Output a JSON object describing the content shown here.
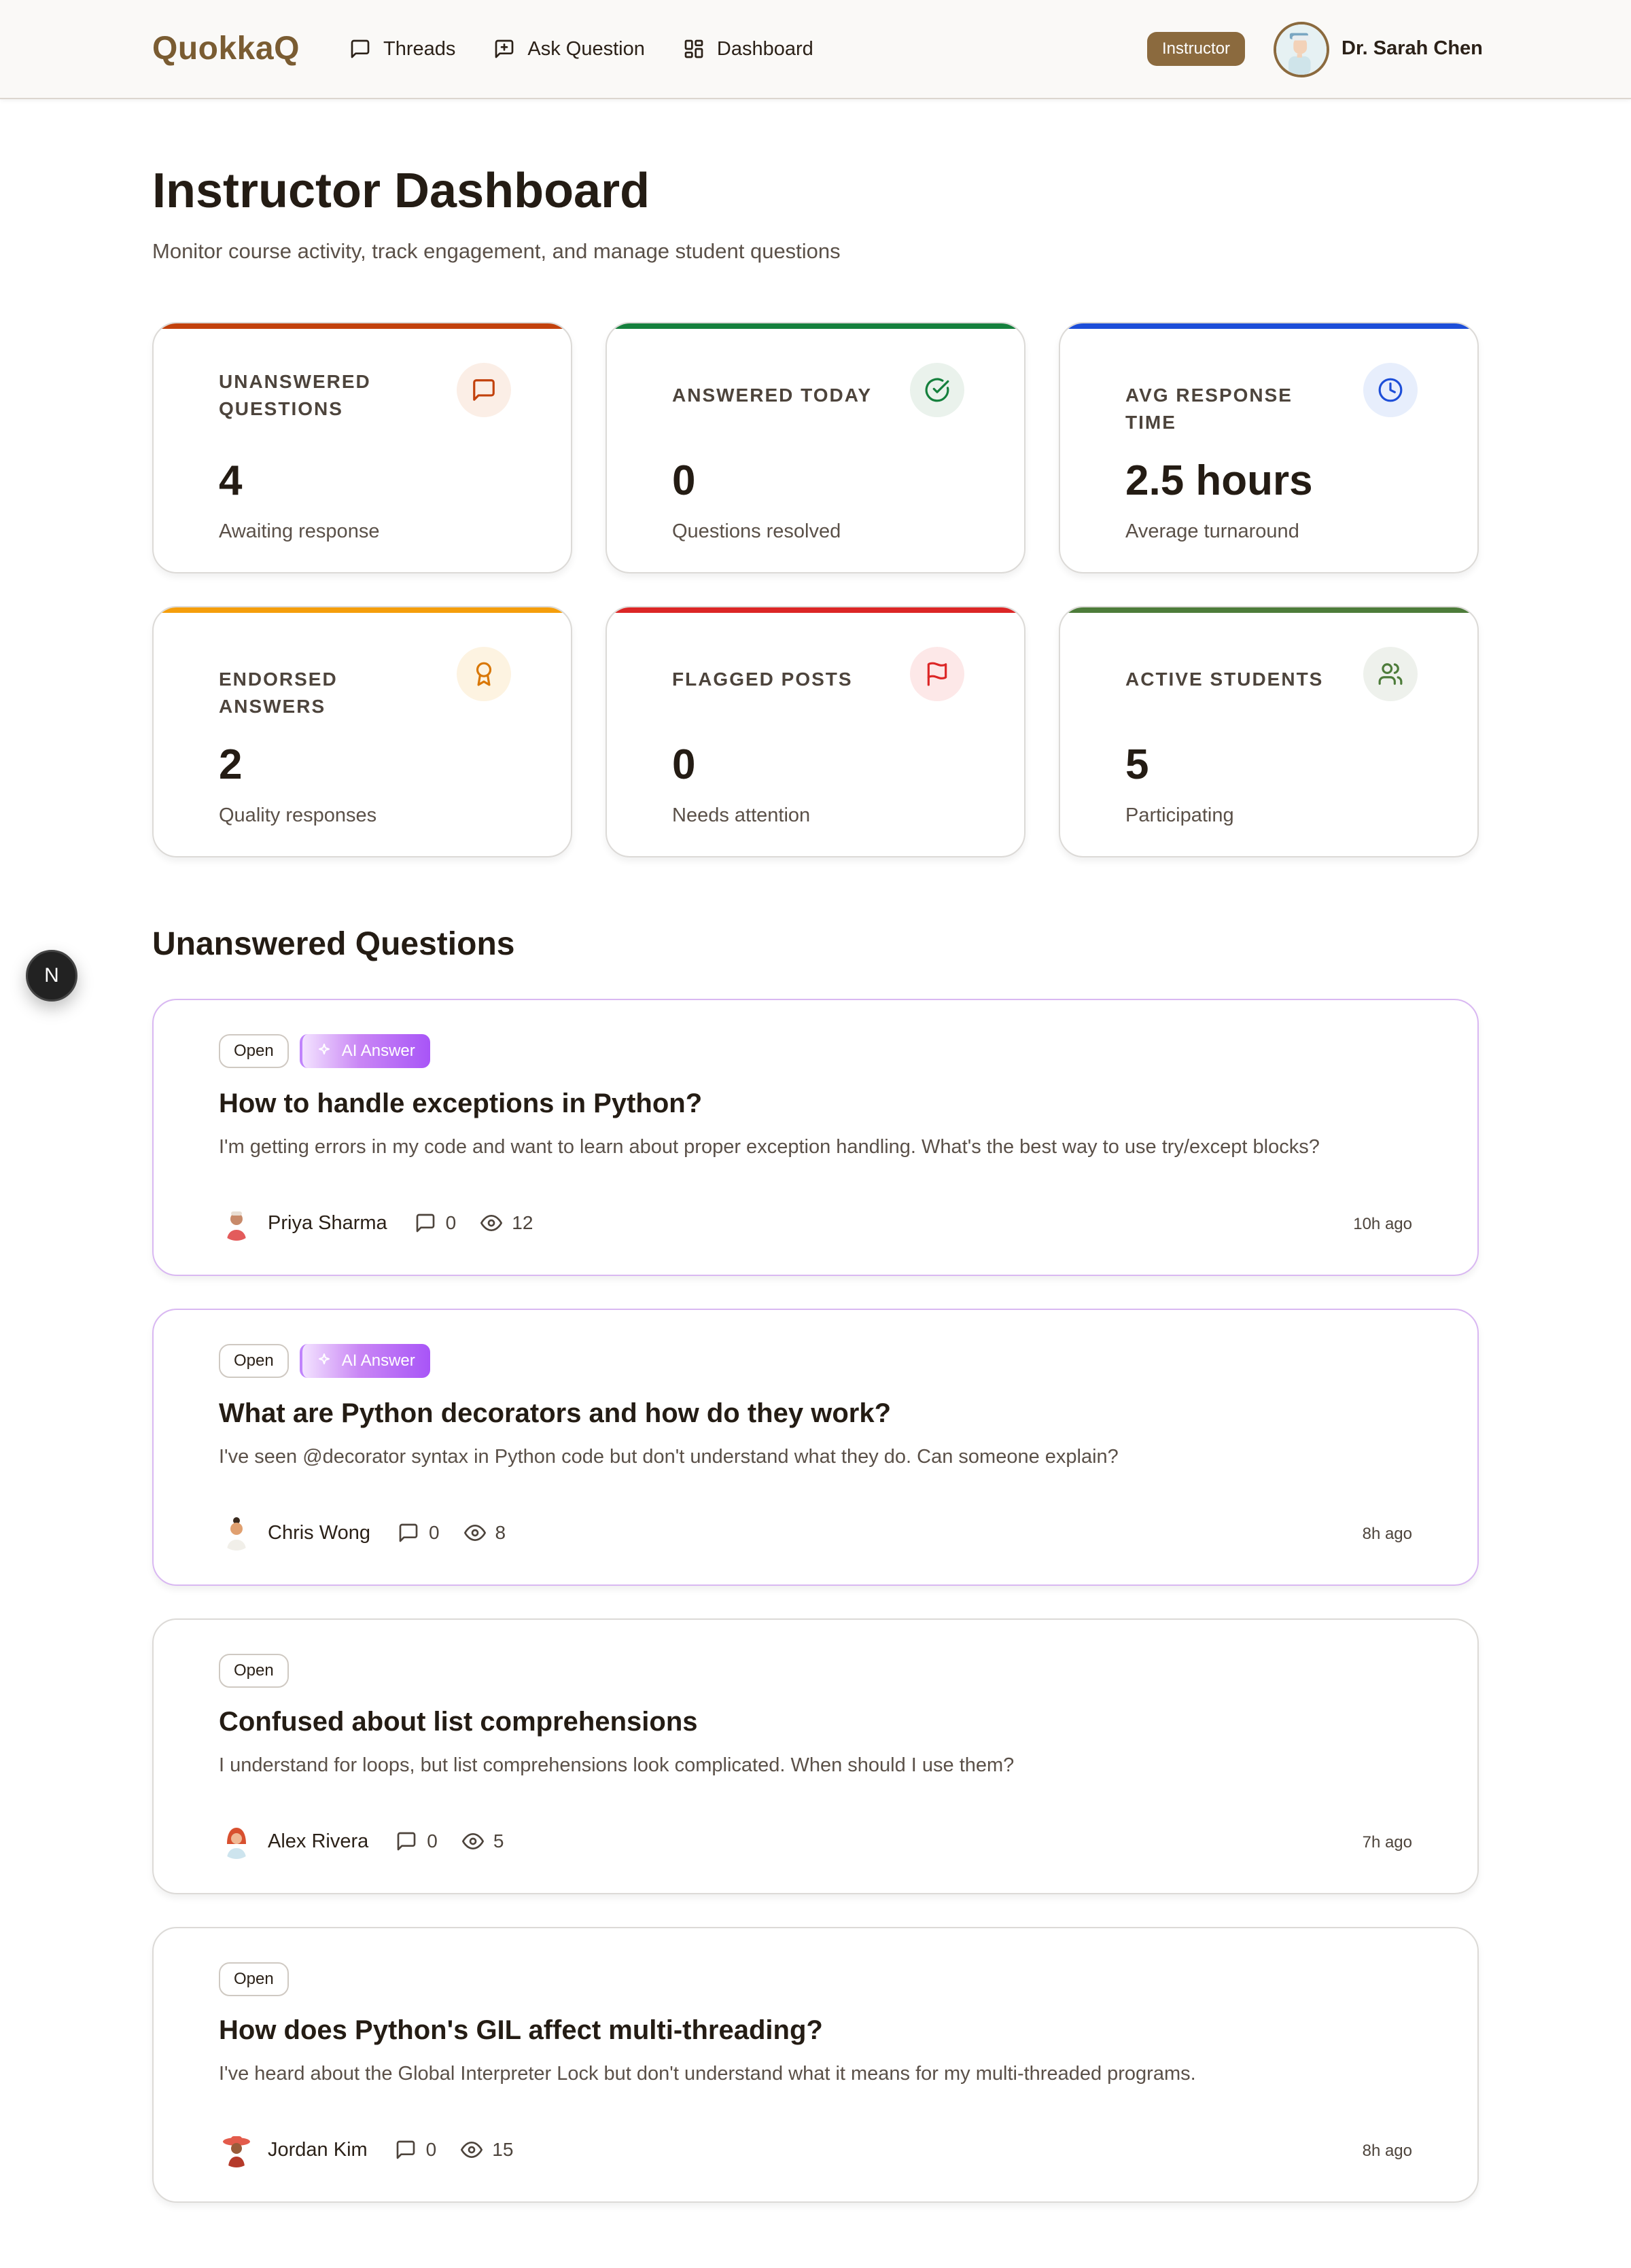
{
  "header": {
    "brand": "QuokkaQ",
    "nav": [
      {
        "label": "Threads",
        "icon": "message-square-icon"
      },
      {
        "label": "Ask Question",
        "icon": "message-plus-icon"
      },
      {
        "label": "Dashboard",
        "icon": "layout-grid-icon"
      }
    ],
    "role_badge": "Instructor",
    "user_name": "Dr. Sarah Chen"
  },
  "page": {
    "title": "Instructor Dashboard",
    "subtitle": "Monitor course activity, track engagement, and manage student questions"
  },
  "stats": [
    {
      "label": "Unanswered Questions",
      "value": "4",
      "caption": "Awaiting response",
      "icon": "message-square-icon",
      "accent": "#c2410c",
      "icon_color": "#c2410c",
      "icon_bg": "#fbeee6"
    },
    {
      "label": "Answered Today",
      "value": "0",
      "caption": "Questions resolved",
      "icon": "check-circle-icon",
      "accent": "#15803d",
      "icon_color": "#15803d",
      "icon_bg": "#eaf2ec"
    },
    {
      "label": "Avg Response Time",
      "value": "2.5 hours",
      "caption": "Average turnaround",
      "icon": "clock-icon",
      "accent": "#1d4ed8",
      "icon_color": "#1d4ed8",
      "icon_bg": "#e7eefc"
    },
    {
      "label": "Endorsed Answers",
      "value": "2",
      "caption": "Quality responses",
      "icon": "award-icon",
      "accent": "#f59e0b",
      "icon_color": "#d97706",
      "icon_bg": "#fdf3e1"
    },
    {
      "label": "Flagged Posts",
      "value": "0",
      "caption": "Needs attention",
      "icon": "flag-icon",
      "accent": "#dc2626",
      "icon_color": "#dc2626",
      "icon_bg": "#fde8e8"
    },
    {
      "label": "Active Students",
      "value": "5",
      "caption": "Participating",
      "icon": "users-icon",
      "accent": "#4d7c3a",
      "icon_color": "#4d7c3a",
      "icon_bg": "#eef1ec"
    }
  ],
  "fab_label": "N",
  "section_title": "Unanswered Questions",
  "questions": [
    {
      "status": "Open",
      "ai_badge": "AI Answer",
      "title": "How to handle exceptions in Python?",
      "excerpt": "I'm getting errors in my code and want to learn about proper exception handling. What's the best way to use try/except blocks?",
      "author": "Priya Sharma",
      "replies": "0",
      "views": "12",
      "time": "10h ago"
    },
    {
      "status": "Open",
      "ai_badge": "AI Answer",
      "title": "What are Python decorators and how do they work?",
      "excerpt": "I've seen @decorator syntax in Python code but don't understand what they do. Can someone explain?",
      "author": "Chris Wong",
      "replies": "0",
      "views": "8",
      "time": "8h ago"
    },
    {
      "status": "Open",
      "title": "Confused about list comprehensions",
      "excerpt": "I understand for loops, but list comprehensions look complicated. When should I use them?",
      "author": "Alex Rivera",
      "replies": "0",
      "views": "5",
      "time": "7h ago"
    },
    {
      "status": "Open",
      "title": "How does Python's GIL affect multi-threading?",
      "excerpt": "I've heard about the Global Interpreter Lock but don't understand what it means for my multi-threaded programs.",
      "author": "Jordan Kim",
      "replies": "0",
      "views": "15",
      "time": "8h ago"
    }
  ]
}
